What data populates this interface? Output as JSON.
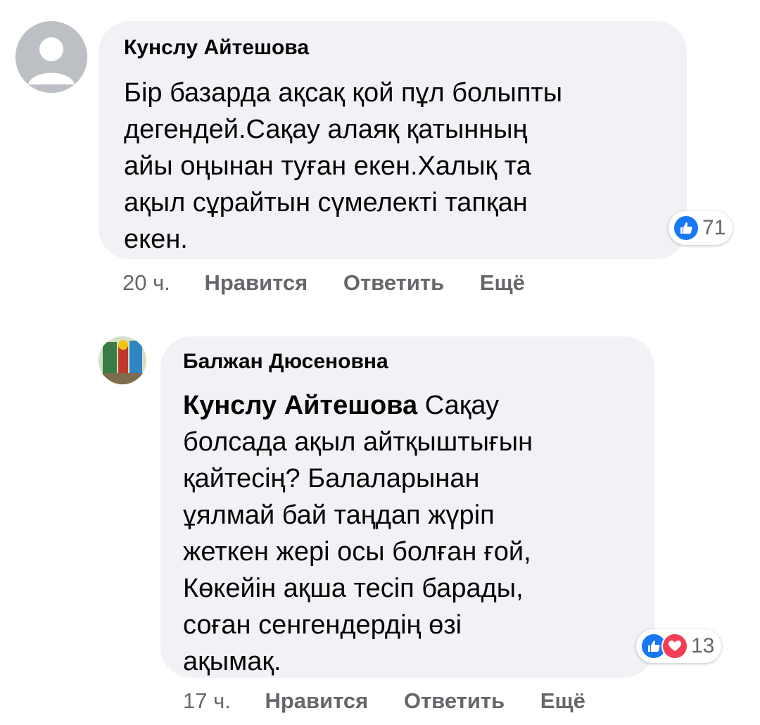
{
  "comments": [
    {
      "author": "Кунслу Айтешова",
      "lines": [
        "Бір базарда ақсақ қой пұл болыпты",
        "дегендей.Сақау алаяқ қатынның",
        "айы оңынан туған екен.Халық та",
        "ақыл сұрайтын сүмелекті тапқан",
        "екен."
      ],
      "reactions": {
        "icons": [
          "like-icon"
        ],
        "count": "71"
      },
      "time": "20 ч.",
      "actions": {
        "like": "Нравится",
        "reply": "Ответить",
        "more": "Ещё"
      }
    },
    {
      "author": "Балжан Дюсеновна",
      "mention": "Кунслу Айтешова",
      "first_line_rest": " Сақау",
      "lines": [
        "болсада ақыл айтқыштығын",
        "қайтесің? Балаларынан",
        "ұялмай бай таңдап жүріп",
        "жеткен жері осы болған ғой,",
        "Көкейін ақша тесіп барады,",
        "соған сенгендердің өзі",
        "ақымақ."
      ],
      "reactions": {
        "icons": [
          "like-icon",
          "love-icon"
        ],
        "count": "13"
      },
      "time": "17 ч.",
      "actions": {
        "like": "Нравится",
        "reply": "Ответить",
        "more": "Ещё"
      }
    }
  ],
  "colors": {
    "bubble": "#f0f2f5",
    "meta": "#65676b",
    "like": "#1877f2",
    "love": "#f33e58"
  }
}
